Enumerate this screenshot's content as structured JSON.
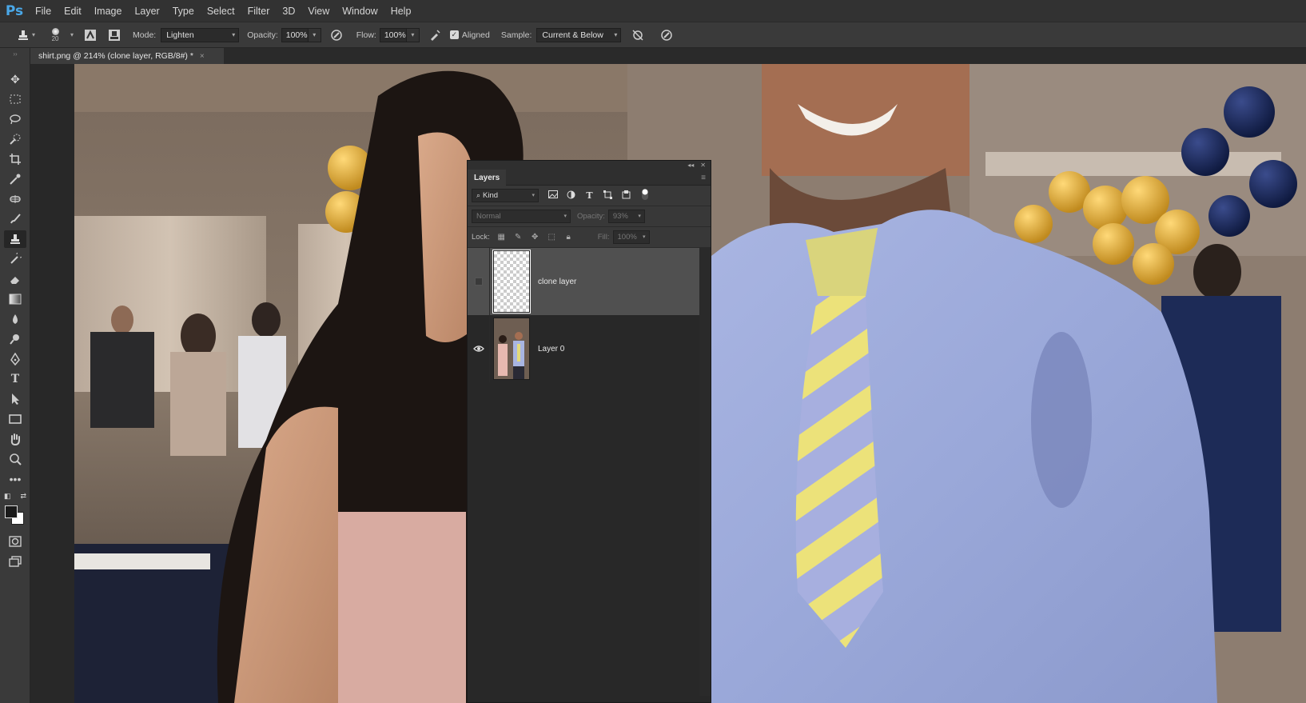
{
  "app": {
    "logo": "Ps"
  },
  "menu": [
    "File",
    "Edit",
    "Image",
    "Layer",
    "Type",
    "Select",
    "Filter",
    "3D",
    "View",
    "Window",
    "Help"
  ],
  "options_bar": {
    "brush_size": "20",
    "mode_label": "Mode:",
    "mode_value": "Lighten",
    "opacity_label": "Opacity:",
    "opacity_value": "100%",
    "flow_label": "Flow:",
    "flow_value": "100%",
    "aligned_label": "Aligned",
    "sample_label": "Sample:",
    "sample_value": "Current & Below"
  },
  "document_tab": {
    "title": "shirt.png @ 214% (clone layer, RGB/8#) *",
    "close": "×"
  },
  "layers_panel": {
    "tab": "Layers",
    "filter_kind": "Kind",
    "blend_mode": "Normal",
    "opacity_label": "Opacity:",
    "opacity_value": "93%",
    "lock_label": "Lock:",
    "fill_label": "Fill:",
    "fill_value": "100%",
    "layers": [
      {
        "name": "clone layer",
        "visible": false,
        "selected": true,
        "thumb": "transparent"
      },
      {
        "name": "Layer 0",
        "visible": true,
        "selected": false,
        "thumb": "photo"
      }
    ]
  },
  "colors": {
    "accent": "#4aa8e8",
    "foreground": "#1a1a1a",
    "background": "#ffffff"
  }
}
